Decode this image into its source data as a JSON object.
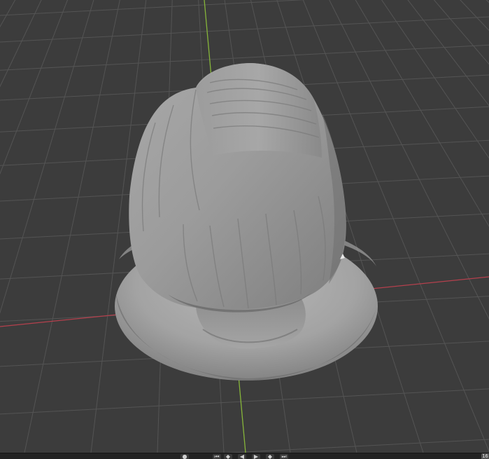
{
  "app": "3D viewport",
  "viewport": {
    "background_color": "#3c3c3c",
    "grid_color": "#545454",
    "x_axis_color": "#b4404d",
    "y_axis_color": "#86b53a",
    "object": "sculpted mesh (head with hair) on oval base",
    "object_color": "#9a9a9a"
  },
  "timeline": {
    "controls": [
      {
        "name": "record-icon",
        "glyph": "●"
      },
      {
        "name": "jump-start-icon",
        "glyph": "⏮"
      },
      {
        "name": "prev-keyframe-icon",
        "glyph": "◆"
      },
      {
        "name": "play-reverse-icon",
        "glyph": "◀"
      },
      {
        "name": "play-icon",
        "glyph": "▶"
      },
      {
        "name": "next-keyframe-icon",
        "glyph": "◆"
      },
      {
        "name": "jump-end-icon",
        "glyph": "⏭"
      }
    ],
    "current_frame": "16"
  }
}
